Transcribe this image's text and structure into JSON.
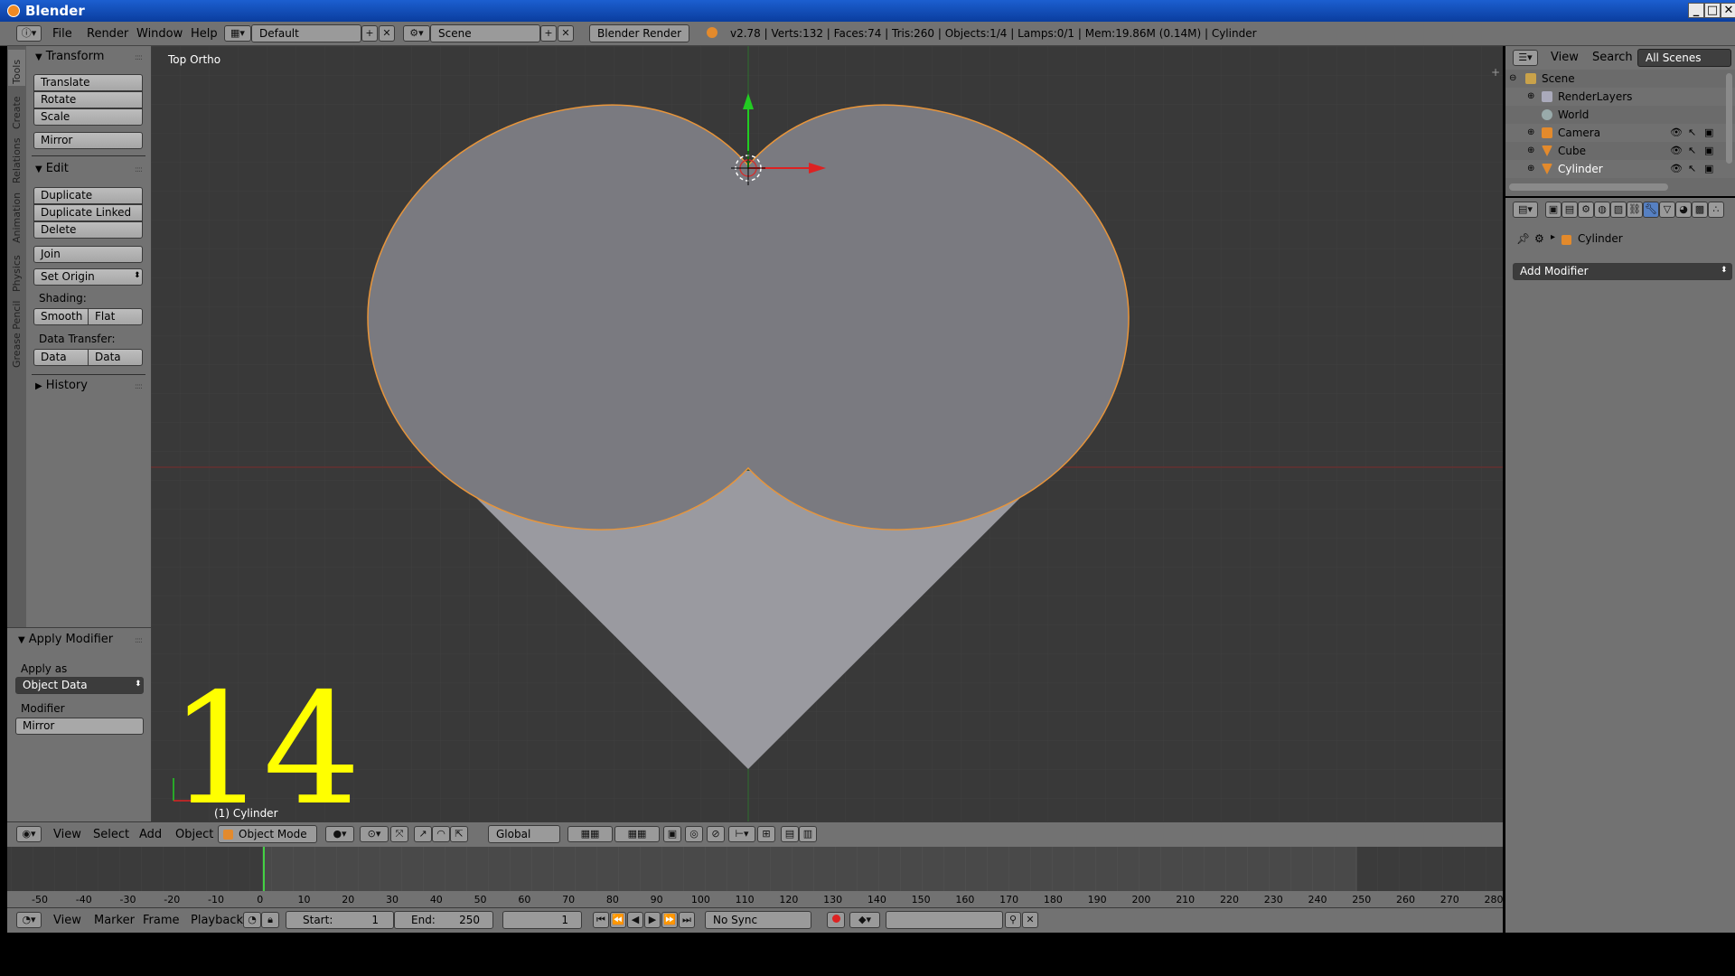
{
  "window": {
    "title": "Blender",
    "controls": [
      "_",
      "□",
      "✕"
    ]
  },
  "menubar": {
    "items": [
      "File",
      "Render",
      "Window",
      "Help"
    ],
    "screen_layout": "Default",
    "scene": "Scene",
    "render_engine": "Blender Render",
    "info": "v2.78 | Verts:132 | Faces:74 | Tris:260 | Objects:1/4 | Lamps:0/1 | Mem:19.86M (0.14M) | Cylinder"
  },
  "side_tabs": [
    "Tools",
    "Create",
    "Relations",
    "Animation",
    "Physics",
    "Grease Pencil"
  ],
  "toolshelf": {
    "transform": {
      "title": "Transform",
      "buttons": [
        "Translate",
        "Rotate",
        "Scale",
        "Mirror"
      ]
    },
    "edit": {
      "title": "Edit",
      "buttons": [
        "Duplicate",
        "Duplicate Linked",
        "Delete",
        "Join"
      ],
      "set_origin": "Set Origin",
      "shading_label": "Shading:",
      "shading": [
        "Smooth",
        "Flat"
      ],
      "data_transfer_label": "Data Transfer:",
      "data_transfer": [
        "Data",
        "Data Layo"
      ]
    },
    "history": {
      "title": "History"
    }
  },
  "redo_panel": {
    "title": "Apply Modifier",
    "apply_as_label": "Apply as",
    "apply_as_value": "Object Data",
    "modifier_label": "Modifier",
    "modifier_value": "Mirror"
  },
  "viewport": {
    "view_label": "Top Ortho",
    "object_label": "(1) Cylinder",
    "overlay_number": "14",
    "colors": {
      "background": "#393939",
      "mesh_fill": "#7a7a80",
      "mesh_lower": "#9a9aa0",
      "outline": "#e8953a"
    }
  },
  "view3d_header": {
    "menus": [
      "View",
      "Select",
      "Add",
      "Object"
    ],
    "mode": "Object Mode",
    "orientation": "Global"
  },
  "timeline": {
    "ticks": [
      -50,
      -40,
      -30,
      -20,
      -10,
      0,
      10,
      20,
      30,
      40,
      50,
      60,
      70,
      80,
      90,
      100,
      110,
      120,
      130,
      140,
      150,
      160,
      170,
      180,
      190,
      200,
      210,
      220,
      230,
      240,
      250,
      260,
      270,
      280
    ],
    "menus": [
      "View",
      "Marker",
      "Frame",
      "Playback"
    ],
    "start_label": "Start:",
    "start": "1",
    "end_label": "End:",
    "end": "250",
    "current": "1",
    "sync": "No Sync"
  },
  "outliner": {
    "menus": [
      "View",
      "Search"
    ],
    "filter": "All Scenes",
    "items": [
      {
        "name": "Scene",
        "icon": "scene-icon"
      },
      {
        "name": "RenderLayers",
        "icon": "renderlayers-icon"
      },
      {
        "name": "World",
        "icon": "world-icon"
      },
      {
        "name": "Camera",
        "icon": "camera-icon"
      },
      {
        "name": "Cube",
        "icon": "mesh-icon"
      },
      {
        "name": "Cylinder",
        "icon": "mesh-icon"
      }
    ]
  },
  "properties": {
    "breadcrumb_object": "Cylinder",
    "add_modifier": "Add Modifier"
  }
}
